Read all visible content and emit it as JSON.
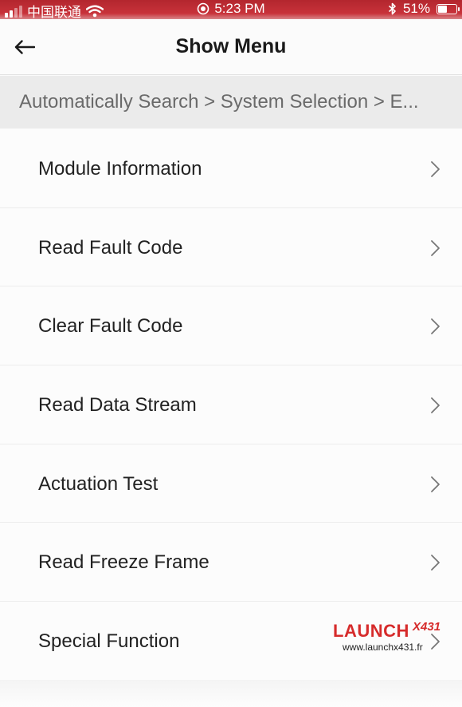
{
  "status_bar": {
    "carrier": "中国联通",
    "time": "5:23 PM",
    "battery": "51%",
    "battery_level": 0.51
  },
  "nav": {
    "title": "Show Menu",
    "back_icon": "arrow-left-icon"
  },
  "breadcrumb": "Automatically Search > System Selection > E...",
  "menu": {
    "items": [
      {
        "label": "Module Information"
      },
      {
        "label": "Read Fault Code"
      },
      {
        "label": "Clear Fault Code"
      },
      {
        "label": "Read Data Stream"
      },
      {
        "label": "Actuation Test"
      },
      {
        "label": "Read Freeze Frame"
      },
      {
        "label": "Special Function"
      }
    ]
  },
  "watermark": {
    "brand": "LAUNCH",
    "model": "X431",
    "url": "www.launchx431.fr"
  },
  "colors": {
    "status_bar": "#c8323a",
    "brand_red": "#d62b2b",
    "breadcrumb_bg": "#ebebeb"
  }
}
